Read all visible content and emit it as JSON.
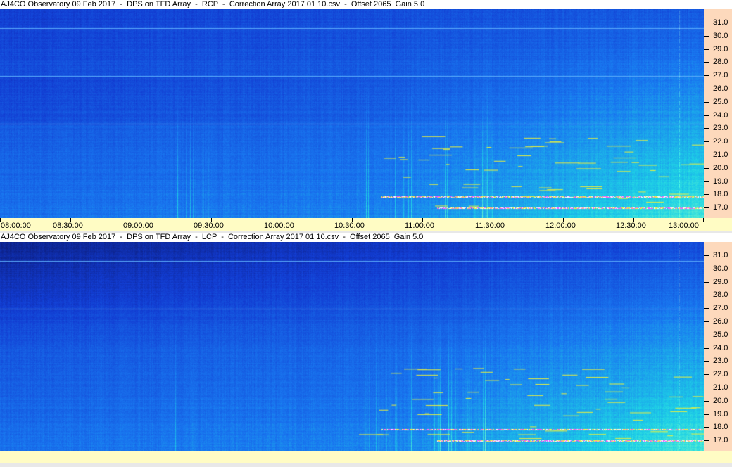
{
  "chart_data": [
    {
      "type": "heatmap",
      "title": "AJ4CO Observatory 09 Feb 2017  -  DPS on TFD Array  -  RCP  -  Correction Array 2017 01 10.csv  -  Offset 2065  Gain 5.0",
      "xlim": [
        "08:00:00",
        "13:00:00"
      ],
      "ylim": [
        16.0,
        32.0
      ],
      "x_ticks": [
        "08:00:00",
        "08:30:00",
        "09:00:00",
        "09:30:00",
        "10:00:00",
        "10:30:00",
        "11:00:00",
        "11:30:00",
        "12:00:00",
        "12:30:00",
        "13:00:00"
      ],
      "y_ticks": [
        "31.0",
        "30.0",
        "29.0",
        "28.0",
        "27.0",
        "26.0",
        "25.0",
        "24.0",
        "23.0",
        "22.0",
        "21.0",
        "20.0",
        "19.0",
        "18.0",
        "17.0"
      ],
      "y_axis_position": "right",
      "colormap": [
        "#0a1a70",
        "#1440d0",
        "#1c80f0",
        "#20d0e8",
        "#ffff40",
        "#ff40ff",
        "#ffffff"
      ]
    },
    {
      "type": "heatmap",
      "title": "AJ4CO Observatory 09 Feb 2017  -  DPS on TFD Array  -  LCP  -  Correction Array 2017 01 10.csv  -  Offset 2065  Gain 5.0",
      "xlim": [
        "08:00:00",
        "13:00:00"
      ],
      "ylim": [
        16.0,
        32.0
      ],
      "x_ticks": [],
      "y_ticks": [
        "31.0",
        "30.0",
        "29.0",
        "28.0",
        "27.0",
        "26.0",
        "25.0",
        "24.0",
        "23.0",
        "22.0",
        "21.0",
        "20.0",
        "19.0",
        "18.0",
        "17.0"
      ],
      "y_axis_position": "right",
      "colormap": [
        "#0a1a70",
        "#1440d0",
        "#1c80f0",
        "#20d0e8",
        "#ffff40",
        "#ff40ff",
        "#ffffff"
      ]
    }
  ]
}
